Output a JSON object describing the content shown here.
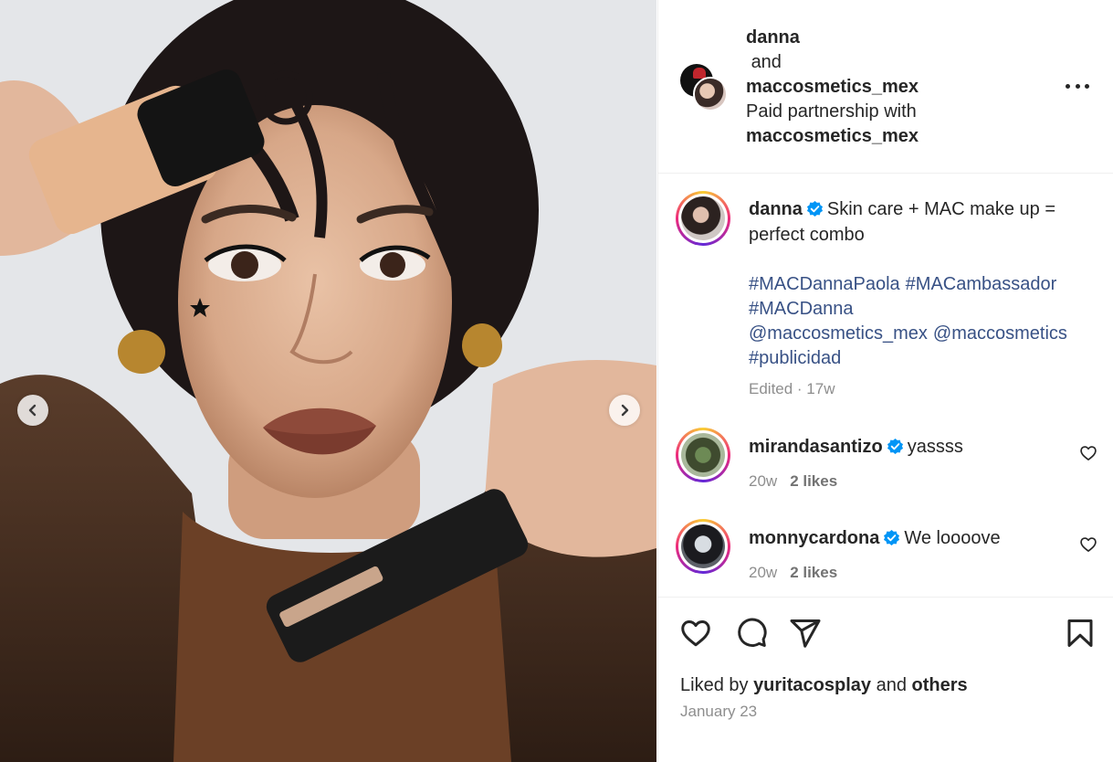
{
  "post": {
    "header": {
      "author": "danna",
      "and_word": "and",
      "coauthor": "maccosmetics_mex",
      "partnership_prefix": "Paid partnership with",
      "partner": "maccosmetics_mex",
      "more_icon": "more-horizontal-icon"
    },
    "media": {
      "prev_icon": "chevron-left-icon",
      "next_icon": "chevron-right-icon"
    },
    "caption": {
      "username": "danna",
      "verified": true,
      "text": "Skin care + MAC make up = perfect combo",
      "hashtags": [
        "#MACDannaPaola",
        "#MACambassador",
        "#MACDanna",
        "@maccosmetics_mex",
        "@maccosmetics",
        "#publicidad"
      ],
      "meta": "Edited · 17w"
    },
    "comments": [
      {
        "username": "mirandasantizo",
        "verified": true,
        "text": "yassss",
        "age": "20w",
        "likes": "2 likes"
      },
      {
        "username": "monnycardona",
        "verified": true,
        "text": "We loooove",
        "age": "20w",
        "likes": "2 likes"
      }
    ],
    "actions": {
      "like_icon": "heart-icon",
      "comment_icon": "comment-icon",
      "share_icon": "share-icon",
      "save_icon": "bookmark-icon",
      "liked_by_prefix": "Liked by",
      "liked_by_user": "yuritacosplay",
      "liked_by_and": "and",
      "liked_by_others": "others",
      "date": "January 23"
    },
    "colors": {
      "link": "#385185",
      "verified": "#0095f6",
      "muted": "#8e8e8e",
      "text": "#262626"
    }
  }
}
